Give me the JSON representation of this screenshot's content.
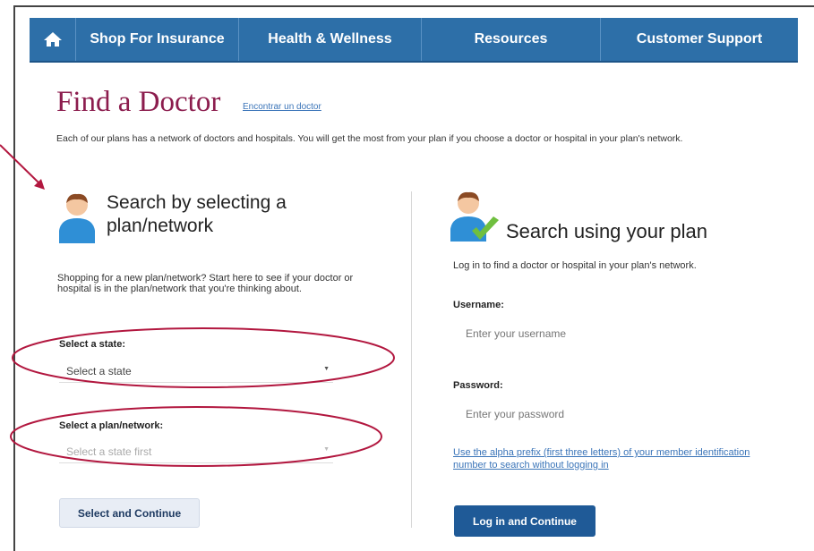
{
  "nav": {
    "home_icon": "home-icon",
    "items": [
      {
        "label": "Shop For Insurance"
      },
      {
        "label": "Health & Wellness"
      },
      {
        "label": "Resources"
      },
      {
        "label": "Customer Support"
      }
    ]
  },
  "page": {
    "title": "Find a Doctor",
    "spanish_link": "Encontrar un doctor",
    "intro": "Each of our plans has a network of doctors and hospitals. You will get the most from your plan if you choose a doctor or hospital in your plan's network."
  },
  "left": {
    "heading": "Search by selecting a plan/network",
    "description": "Shopping for a new plan/network? Start here to see if your doctor or hospital is in the plan/network that you're thinking about.",
    "state_label": "Select a state:",
    "state_value": "Select a state",
    "plan_label": "Select a plan/network:",
    "plan_value": "Select a state first",
    "button": "Select and Continue"
  },
  "right": {
    "heading": "Search using your plan",
    "description": "Log in to find a doctor or hospital in your plan's network.",
    "username_label": "Username:",
    "username_placeholder": "Enter your username",
    "password_label": "Password:",
    "password_placeholder": "Enter your password",
    "help_link": "Use the alpha prefix (first three letters) of your member identification number to search without logging in",
    "button": "Log in and Continue"
  },
  "colors": {
    "nav": "#2d6fa8",
    "title": "#8c1d4e",
    "annotation": "#b2173f",
    "primary_button": "#1f5a97"
  }
}
